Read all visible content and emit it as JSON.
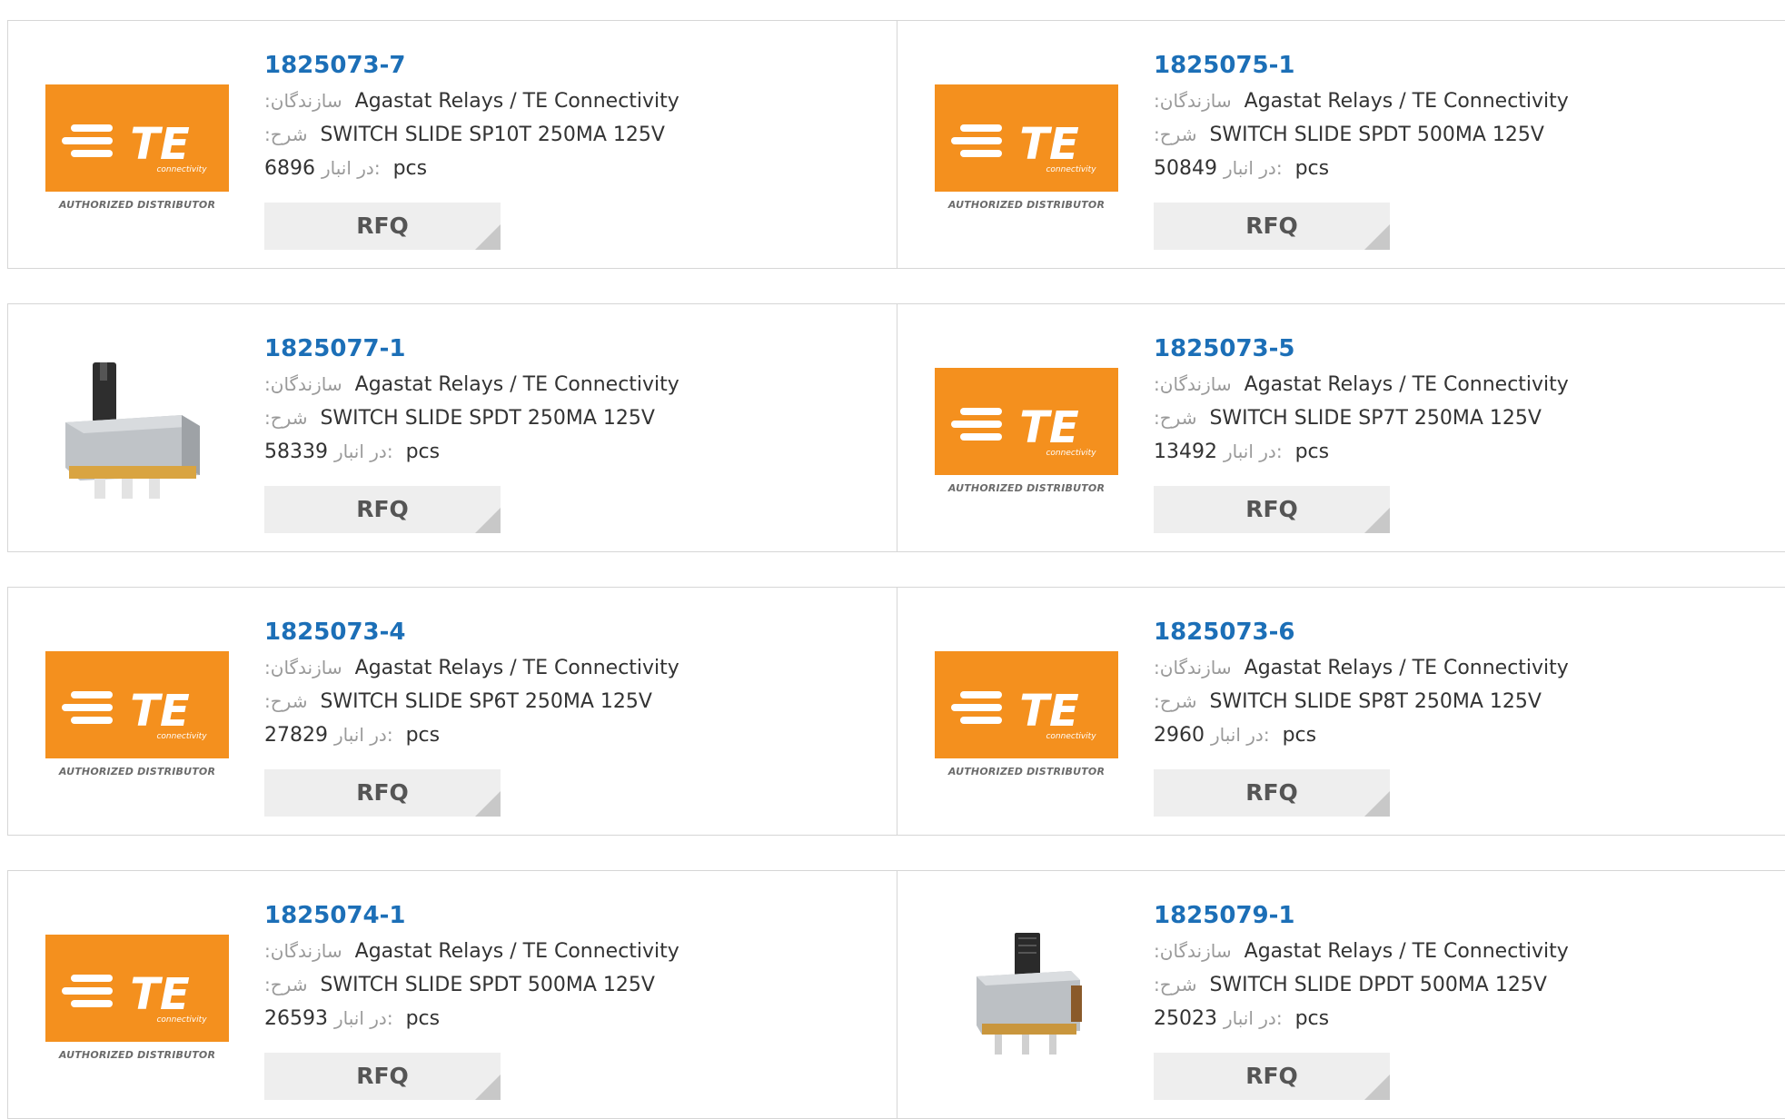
{
  "labels": {
    "manufacturer": ":سازندگان",
    "description": ":شرح",
    "stock": "در انبار:",
    "unit": "pcs",
    "rfq": "RFQ",
    "logo_text": "TE",
    "logo_sub": "connectivity",
    "distributor": "AUTHORIZED DISTRIBUTOR"
  },
  "colors": {
    "link": "#1c6fb7",
    "logo_orange": "#f4901e",
    "button_bg": "#eeeeee"
  },
  "products": [
    {
      "part": "1825073-7",
      "manufacturer": "Agastat Relays / TE Connectivity",
      "description": "SWITCH SLIDE SP10T 250MA 125V",
      "stock": "6896",
      "image": "te-logo"
    },
    {
      "part": "1825075-1",
      "manufacturer": "Agastat Relays / TE Connectivity",
      "description": "SWITCH SLIDE SPDT 500MA 125V",
      "stock": "50849",
      "image": "te-logo"
    },
    {
      "part": "1825077-1",
      "manufacturer": "Agastat Relays / TE Connectivity",
      "description": "SWITCH SLIDE SPDT 250MA 125V",
      "stock": "58339",
      "image": "slide-switch-photo"
    },
    {
      "part": "1825073-5",
      "manufacturer": "Agastat Relays / TE Connectivity",
      "description": "SWITCH SLIDE SP7T 250MA 125V",
      "stock": "13492",
      "image": "te-logo"
    },
    {
      "part": "1825073-4",
      "manufacturer": "Agastat Relays / TE Connectivity",
      "description": "SWITCH SLIDE SP6T 250MA 125V",
      "stock": "27829",
      "image": "te-logo"
    },
    {
      "part": "1825073-6",
      "manufacturer": "Agastat Relays / TE Connectivity",
      "description": "SWITCH SLIDE SP8T 250MA 125V",
      "stock": "2960",
      "image": "te-logo"
    },
    {
      "part": "1825074-1",
      "manufacturer": "Agastat Relays / TE Connectivity",
      "description": "SWITCH SLIDE SPDT 500MA 125V",
      "stock": "26593",
      "image": "te-logo"
    },
    {
      "part": "1825079-1",
      "manufacturer": "Agastat Relays / TE Connectivity",
      "description": "SWITCH SLIDE DPDT 500MA 125V",
      "stock": "25023",
      "image": "dpdt-switch-photo"
    }
  ]
}
